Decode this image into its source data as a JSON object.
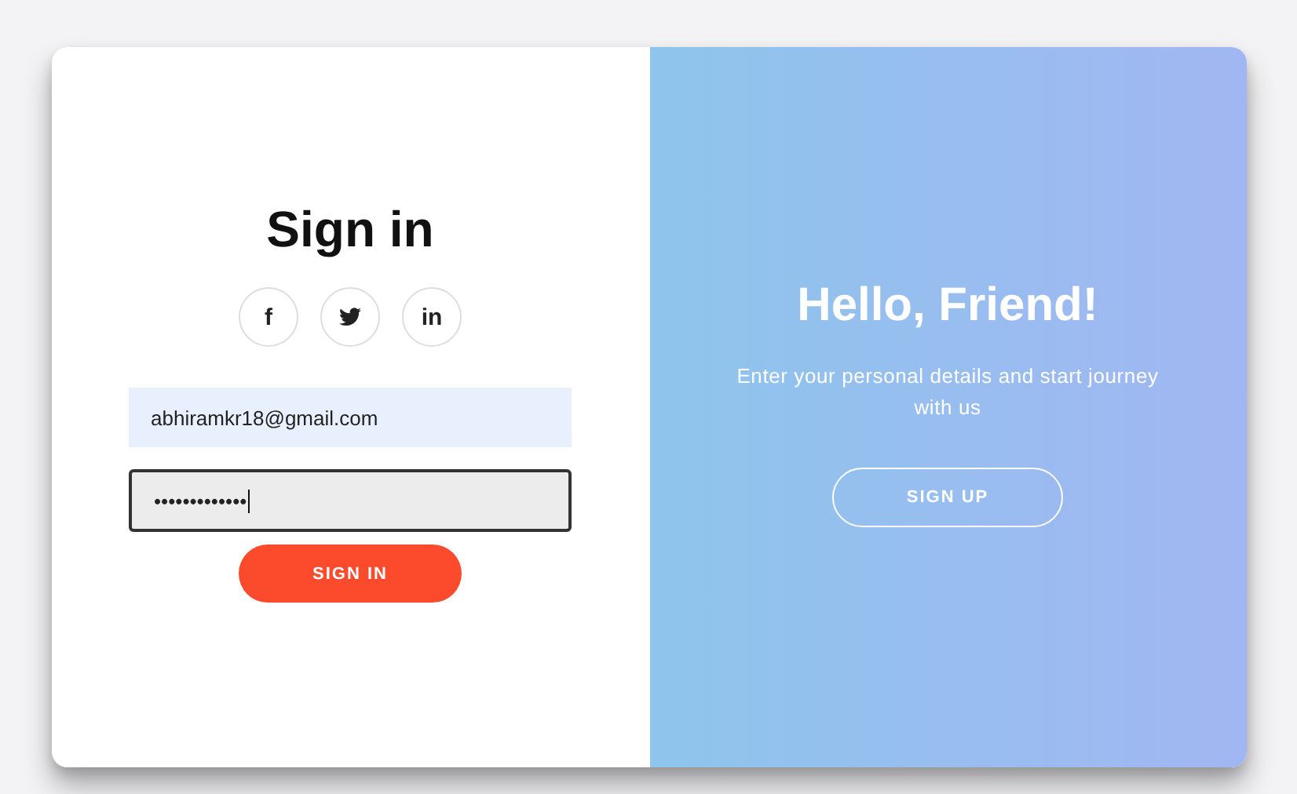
{
  "sign_in": {
    "title": "Sign in",
    "social": [
      {
        "kind": "text",
        "label": "f"
      },
      {
        "kind": "bird"
      },
      {
        "kind": "text",
        "label": "in"
      }
    ],
    "fields": [
      {
        "value": "abhiramkr18@gmail.com",
        "focused": false
      },
      {
        "value": "•••••••••••••",
        "focused": true
      }
    ],
    "button": "SIGN IN"
  },
  "overlay": {
    "title": "Hello, Friend!",
    "text": "Enter your personal details and start journey with us",
    "button": "SIGN UP"
  }
}
